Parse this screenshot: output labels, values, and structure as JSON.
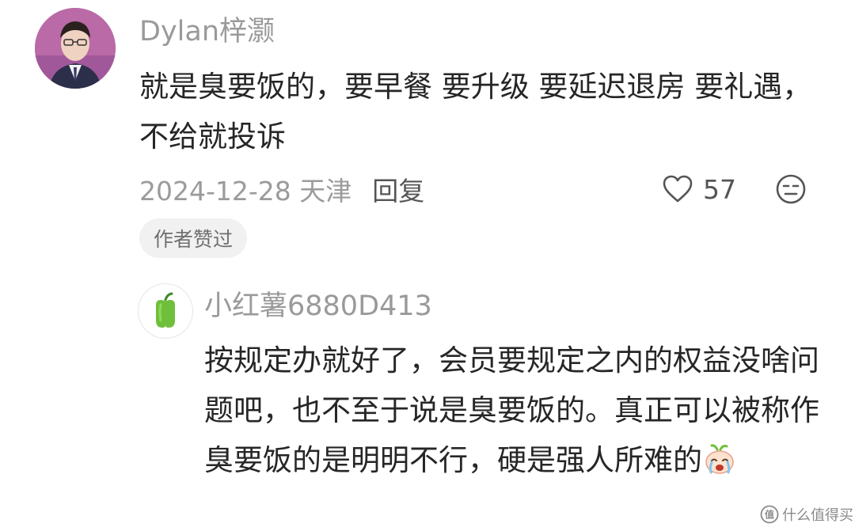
{
  "comment": {
    "username": "Dylan梓灏",
    "text": "就是臭要饭的，要早餐 要升级 要延迟退房 要礼遇，不给就投诉",
    "date_location": "2024-12-28 天津",
    "reply_label": "回复",
    "like_count": "57",
    "author_badge": "作者赞过",
    "icons": [
      "avatar",
      "heart-icon",
      "dislike-face-icon"
    ]
  },
  "reply": {
    "username": "小红薯6880D413",
    "text": "按规定办就好了，会员要规定之内的权益没啥问题吧，也不至于说是臭要饭的。真正可以被称作臭要饭的是明明不行，硬是强人所难的",
    "icons": [
      "pepper-avatar-icon",
      "crying-emoji-icon"
    ]
  },
  "watermark": {
    "text": "什么值得买",
    "icon": "smzdm-logo-icon"
  },
  "colors": {
    "text_primary": "#262626",
    "text_secondary": "#9b9b9b",
    "badge_bg": "#f1f1f1",
    "avatar_bg": "#b96aa7",
    "pepper_green": "#6fbf3a"
  }
}
